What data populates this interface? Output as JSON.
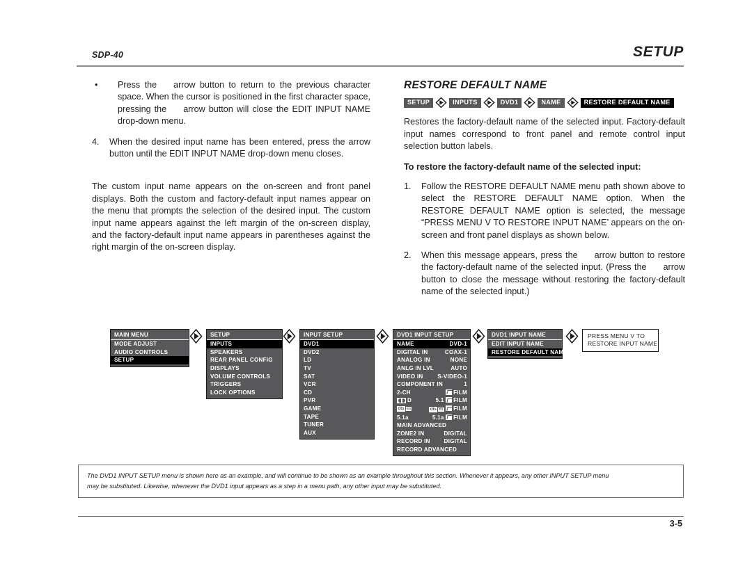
{
  "header": {
    "model": "SDP-40",
    "section": "SETUP"
  },
  "left_column": {
    "bullet": {
      "marker": "•",
      "text_a": "Press the",
      "text_b": "arrow button to return to the previous character space. When the cursor is positioned in the first character space, pressing the",
      "text_c": "arrow button will close the EDIT INPUT NAME drop-down menu."
    },
    "step4": {
      "marker": "4.",
      "text": "When the desired input name has been entered, press the arrow button until the EDIT INPUT NAME drop-down menu closes."
    },
    "paragraph": "The custom input name appears on the on-screen and front panel displays. Both the custom and factory-default input names appear on the menu that prompts the selection of the desired input. The custom input name appears against the left margin of the on-screen display, and the factory-default input name appears in parentheses against the right margin of the on-screen display."
  },
  "right_column": {
    "subhead": "RESTORE DEFAULT NAME",
    "breadcrumbs": [
      {
        "label": "SETUP",
        "final": false
      },
      {
        "label": "INPUTS",
        "final": false
      },
      {
        "label": "DVD1",
        "final": false
      },
      {
        "label": "NAME",
        "final": false
      },
      {
        "label": "RESTORE DEFAULT NAME",
        "final": true
      }
    ],
    "intro": "Restores the factory-default name of the selected input. Factory-default input names correspond to front panel and remote control input selection button labels.",
    "bold_lead": "To restore the factory-default name of the selected input:",
    "step1": {
      "marker": "1.",
      "text": "Follow the RESTORE DEFAULT NAME menu path shown above to select the RESTORE DEFAULT NAME option. When the RESTORE DEFAULT NAME option is selected, the message “PRESS MENU V TO RESTORE INPUT NAME’ appears on the on-screen and front panel displays as shown below."
    },
    "step2": {
      "marker": "2.",
      "text_a": "When this message appears, press the",
      "text_b": "arrow button to restore the factory-default name of the selected input. (Press the",
      "text_c": "arrow button to close the message without restoring the factory-default name of the selected input.)"
    }
  },
  "diagram": {
    "main_menu": {
      "title": "MAIN MENU",
      "rows": [
        {
          "label": "MODE ADJUST",
          "selected": false
        },
        {
          "label": "AUDIO CONTROLS",
          "selected": false
        },
        {
          "label": "SETUP",
          "selected": true
        }
      ]
    },
    "setup_menu": {
      "title": "SETUP",
      "rows": [
        {
          "label": "INPUTS",
          "selected": true
        },
        {
          "label": "SPEAKERS",
          "selected": false
        },
        {
          "label": "REAR PANEL CONFIG",
          "selected": false
        },
        {
          "label": "DISPLAYS",
          "selected": false
        },
        {
          "label": "VOLUME CONTROLS",
          "selected": false
        },
        {
          "label": "TRIGGERS",
          "selected": false
        },
        {
          "label": "LOCK OPTIONS",
          "selected": false
        }
      ]
    },
    "input_setup": {
      "title": "INPUT SETUP",
      "rows": [
        {
          "label": "DVD1",
          "selected": true
        },
        {
          "label": "DVD2",
          "selected": false
        },
        {
          "label": "LD",
          "selected": false
        },
        {
          "label": "TV",
          "selected": false
        },
        {
          "label": "SAT",
          "selected": false
        },
        {
          "label": "VCR",
          "selected": false
        },
        {
          "label": "CD",
          "selected": false
        },
        {
          "label": "PVR",
          "selected": false
        },
        {
          "label": "GAME",
          "selected": false
        },
        {
          "label": "TAPE",
          "selected": false
        },
        {
          "label": "TUNER",
          "selected": false
        },
        {
          "label": "AUX",
          "selected": false
        }
      ]
    },
    "dvd1_input_setup": {
      "title": "DVD1 INPUT SETUP",
      "rows": [
        {
          "label": "NAME",
          "value": "DVD-1",
          "selected": true
        },
        {
          "label": "DIGITAL IN",
          "value": "COAX-1",
          "selected": false
        },
        {
          "label": "ANALOG IN",
          "value": "NONE",
          "selected": false
        },
        {
          "label": "ANLG IN LVL",
          "value": "AUTO",
          "selected": false
        },
        {
          "label": "VIDEO IN",
          "value": "S-VIDEO-1",
          "selected": false
        },
        {
          "label": "COMPONENT IN",
          "value": "1",
          "selected": false
        },
        {
          "label": "2-CH",
          "value": "FILM",
          "selected": false,
          "value_icon": "film-icon"
        },
        {
          "label": "D",
          "value": "5.1",
          "selected": false,
          "label_icon": "dolby-digital-logo",
          "value2": "FILM",
          "value_icon": "film-icon"
        },
        {
          "label": "",
          "value": "",
          "selected": false,
          "label_icon": "dts-logo",
          "value_logo": "dts-logo",
          "value2": "FILM",
          "value_icon": "film-icon"
        },
        {
          "label": "5.1a",
          "value": "5.1a",
          "selected": false,
          "value2": "FILM",
          "value_icon": "film-icon"
        },
        {
          "label": "MAIN ADVANCED",
          "value": "",
          "selected": false
        },
        {
          "label": "ZONE2 IN",
          "value": "DIGITAL",
          "selected": false
        },
        {
          "label": "RECORD IN",
          "value": "DIGITAL",
          "selected": false
        },
        {
          "label": "RECORD ADVANCED",
          "value": "",
          "selected": false
        }
      ]
    },
    "dvd1_input_name": {
      "title": "DVD1 INPUT NAME",
      "rows": [
        {
          "label": "EDIT INPUT NAME",
          "selected": false
        },
        {
          "label": "RESTORE DEFAULT NAME",
          "selected": true
        }
      ]
    },
    "message_box": {
      "line1": "PRESS MENU V TO",
      "line2": "RESTORE INPUT NAME"
    },
    "dts_mark": "dts",
    "dts_sub": "ES",
    "film_label": "FILM"
  },
  "footnote": {
    "line1": "The DVD1 INPUT SETUP menu is shown here as an example, and will continue to be shown as an example throughout this section. Whenever it appears, any other INPUT SETUP menu",
    "line2": "may be substituted. Likewise, whenever the DVD1 input appears as a step in a menu path, any other input may be substituted."
  },
  "folio": {
    "page": "3-5"
  }
}
